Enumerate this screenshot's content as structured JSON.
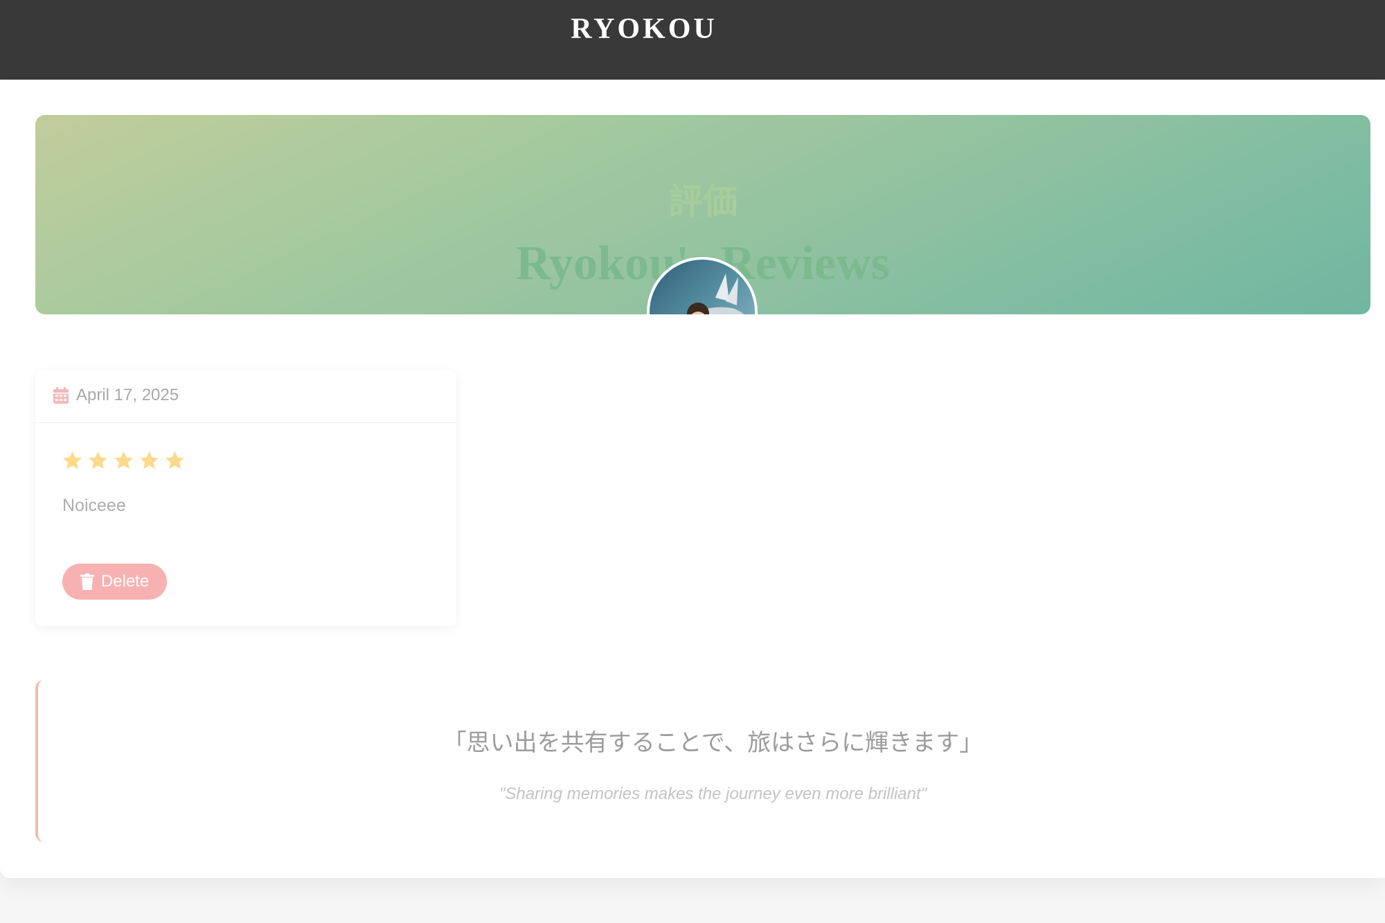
{
  "header": {
    "brand": "RYOKOU"
  },
  "hero": {
    "japanese_title": "評価",
    "title": "Ryokou's Reviews",
    "avatar_icon": "avatar-image"
  },
  "review": {
    "date_icon": "calendar-icon",
    "date": "April 17, 2025",
    "rating": 5,
    "rating_max": 5,
    "star_icon": "star-icon",
    "text": "Noiceee",
    "delete_label": "Delete",
    "delete_icon": "trash-icon"
  },
  "quote": {
    "japanese": "「思い出を共有することで、旅はさらに輝きます」",
    "english": "\"Sharing memories makes the journey even more brilliant\""
  },
  "colors": {
    "topbar": "#393939",
    "hero_gradient_start": "#c2cc9b",
    "hero_gradient_end": "#70b6a0",
    "accent_pink": "#f8b1b1",
    "star_yellow": "#fcd98b",
    "calendar_pink": "#f4b8b8"
  }
}
